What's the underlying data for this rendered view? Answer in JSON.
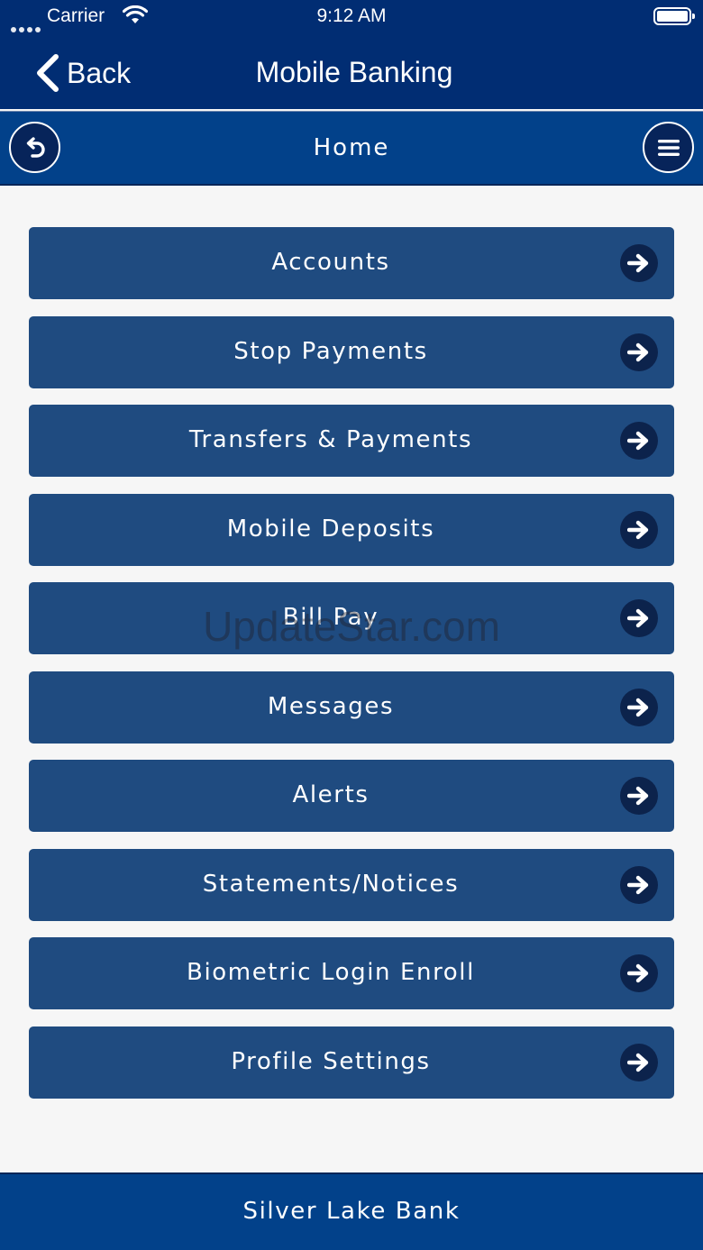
{
  "status_bar": {
    "carrier": "Carrier",
    "time": "9:12 AM"
  },
  "nav_bar": {
    "back_label": "Back",
    "title": "Mobile Banking"
  },
  "sub_header": {
    "title": "Home"
  },
  "menu": {
    "items": [
      {
        "label": "Accounts"
      },
      {
        "label": "Stop Payments"
      },
      {
        "label": "Transfers & Payments"
      },
      {
        "label": "Mobile Deposits"
      },
      {
        "label": "Bill Pay"
      },
      {
        "label": "Messages"
      },
      {
        "label": "Alerts"
      },
      {
        "label": "Statements/Notices"
      },
      {
        "label": "Biometric Login Enroll"
      },
      {
        "label": "Profile Settings"
      }
    ]
  },
  "watermark": "UpdateStar.com",
  "footer": {
    "bank_name": "Silver Lake Bank"
  },
  "colors": {
    "nav_bar": "#012d73",
    "sub_header": "#02418a",
    "menu_button": "#1f4b80",
    "arrow_circle": "#0c234c",
    "background": "#f6f6f6"
  },
  "icons": {
    "back": "chevron-left-icon",
    "undo": "undo-arrow-icon",
    "menu": "hamburger-menu-icon",
    "item_arrow": "arrow-right-icon"
  }
}
